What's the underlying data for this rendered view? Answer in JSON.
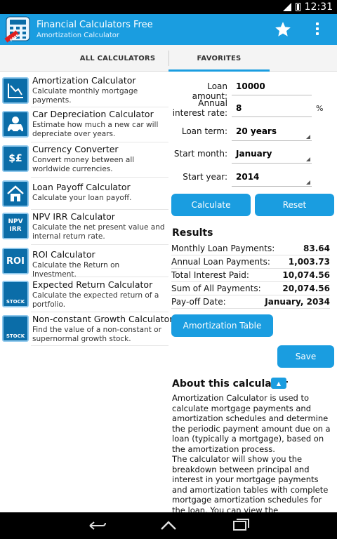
{
  "status": {
    "time": "12:31"
  },
  "app": {
    "title": "Financial Calculators Free",
    "subtitle": "Amortization Calculator",
    "icon_badge": "FREE"
  },
  "tabs": [
    {
      "label": "ALL CALCULATORS",
      "selected": false
    },
    {
      "label": "FAVORITES",
      "selected": true
    }
  ],
  "calculators": [
    {
      "name": "Amortization Calculator",
      "desc": "Calculate monthly mortgage payments.",
      "icon": "amortization-chart-icon",
      "icon_text": ""
    },
    {
      "name": "Car Depreciation Calculator",
      "desc": "Estimate how much a new car will depreciate over years.",
      "icon": "car-icon",
      "icon_text": ""
    },
    {
      "name": "Currency Converter",
      "desc": "Convert money between all worldwide currencies.",
      "icon": "currency-icon",
      "icon_text": "$£"
    },
    {
      "name": "Loan Payoff Calculator",
      "desc": "Calculate your loan payoff.",
      "icon": "house-icon",
      "icon_text": ""
    },
    {
      "name": "NPV IRR Calculator",
      "desc": "Calculate the net present value and internal return rate.",
      "icon": "npv-irr-icon",
      "icon_text": "NPV IRR"
    },
    {
      "name": "ROI Calculator",
      "desc": "Calculate the Return on Investment.",
      "icon": "roi-icon",
      "icon_text": "ROI"
    },
    {
      "name": "Expected Return Calculator",
      "desc": "Calculate the expected return of a portfolio.",
      "icon": "stock-chart-icon",
      "icon_text": "STOCK"
    },
    {
      "name": "Non-constant Growth Calculator",
      "desc": "Find the value of a non-constant or supernormal growth stock.",
      "icon": "stock-growth-icon",
      "icon_text": "STOCK"
    }
  ],
  "form": {
    "loan_amount": {
      "label": "Loan amount:",
      "value": "10000"
    },
    "interest_rate": {
      "label": "Annual interest rate:",
      "value": "8",
      "unit": "%"
    },
    "loan_term": {
      "label": "Loan term:",
      "value": "20 years"
    },
    "start_month": {
      "label": "Start month:",
      "value": "January"
    },
    "start_year": {
      "label": "Start year:",
      "value": "2014"
    }
  },
  "buttons": {
    "calculate": "Calculate",
    "reset": "Reset",
    "amortization_table": "Amortization Table",
    "save": "Save"
  },
  "results": {
    "title": "Results",
    "rows": [
      {
        "label": "Monthly Loan Payments:",
        "value": "83.64"
      },
      {
        "label": "Annual Loan Payments:",
        "value": "1,003.73"
      },
      {
        "label": "Total Interest Paid:",
        "value": "10,074.56"
      },
      {
        "label": "Sum of All Payments:",
        "value": "20,074.56"
      },
      {
        "label": "Pay-off Date:",
        "value": "January, 2034"
      }
    ]
  },
  "about": {
    "title": "About this calculator",
    "toggle": "▲",
    "p1": "Amortization Calculator is used to calculate mortgage payments and amortization schedules and determine the periodic payment amount due on a loan (typically a mortgage), based on the amortization process.",
    "p2": "The calculator will show you the breakdown between principal and interest in your mortgage payments and amortization tables with complete mortgage amortization schedules for the loan. You can view the amortization table"
  },
  "colors": {
    "accent": "#1a9de0",
    "icon_bg": "#0b6da8"
  }
}
